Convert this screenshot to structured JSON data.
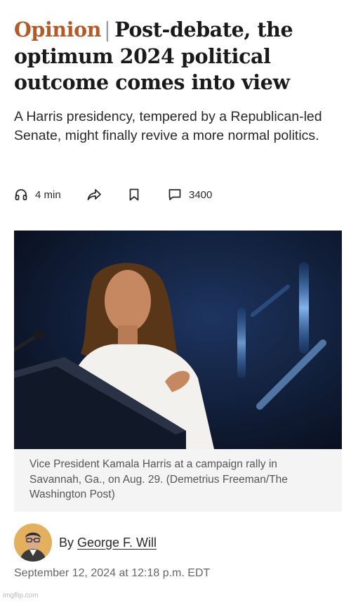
{
  "article": {
    "kicker": "Opinion",
    "separator": "|",
    "headline": "Post-debate, the optimum 2024 political outcome comes into view",
    "subheadline": "A Harris presidency, tempered by a Republican-led Senate, might finally revive a more normal politics."
  },
  "toolbar": {
    "listen_icon": "headphones-icon",
    "listen_label": "4 min",
    "share_icon": "share-icon",
    "save_icon": "bookmark-icon",
    "comments_icon": "comment-icon",
    "comments_count": "3400"
  },
  "photo": {
    "subject": "Woman in a white suit speaking at a podium against a dark blue stage background",
    "caption": "Vice President Kamala Harris at a campaign rally in Savannah, Ga., on Aug. 29. (Demetrius Freeman/The Washington Post)"
  },
  "byline": {
    "prefix": "By",
    "author": "George F. Will",
    "timestamp": "September 12, 2024 at 12:18 p.m. EDT"
  },
  "watermark": "imgflip.com",
  "colors": {
    "kicker": "#b45a28",
    "text": "#1a1a1a",
    "caption_bg": "#f4f4f4",
    "photo_bg": "#0b1022"
  }
}
